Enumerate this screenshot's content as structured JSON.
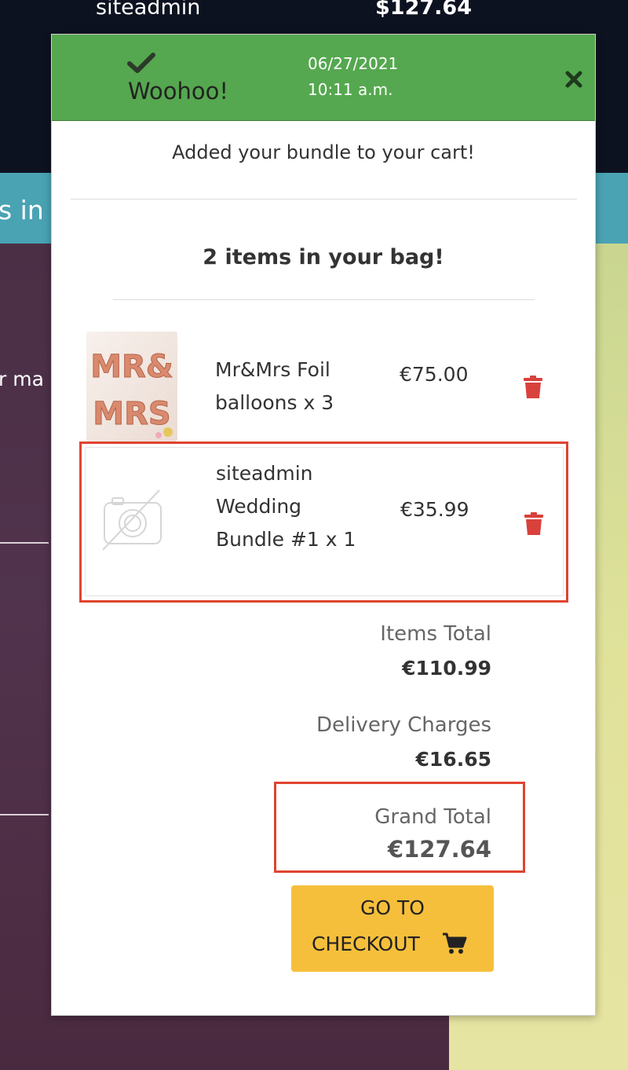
{
  "background": {
    "top_user": "siteadmin",
    "top_amount": "$127.64",
    "teal_text": "s in",
    "left_text": "r ma"
  },
  "toast": {
    "title": "Woohoo!",
    "date": "06/27/2021",
    "time": "10:11 a.m.",
    "icon": "check-icon",
    "close_icon": "close-icon",
    "message": "Added your bundle to your cart!"
  },
  "bag": {
    "count_text": "2 items in your bag!",
    "items": [
      {
        "name": "Mr&Mrs Foil balloons x 3",
        "price": "€75.00",
        "image_text": "MR & MRS"
      },
      {
        "name": "siteadmin Wedding Bundle #1 x 1",
        "price": "€35.99",
        "image_icon": "no-image-camera-icon"
      }
    ]
  },
  "totals": {
    "items_total_label": "Items Total",
    "items_total_value": "€110.99",
    "delivery_label": "Delivery Charges",
    "delivery_value": "€16.65",
    "grand_total_label": "Grand Total",
    "grand_total_value": "€127.64"
  },
  "checkout": {
    "line1": "GO TO",
    "line2": "CHECKOUT",
    "icon": "cart-icon"
  },
  "colors": {
    "header_green": "#55a84f",
    "delete_red": "#d9413c",
    "checkout_yellow": "#f6bf3b",
    "highlight_red": "#e0432f"
  }
}
